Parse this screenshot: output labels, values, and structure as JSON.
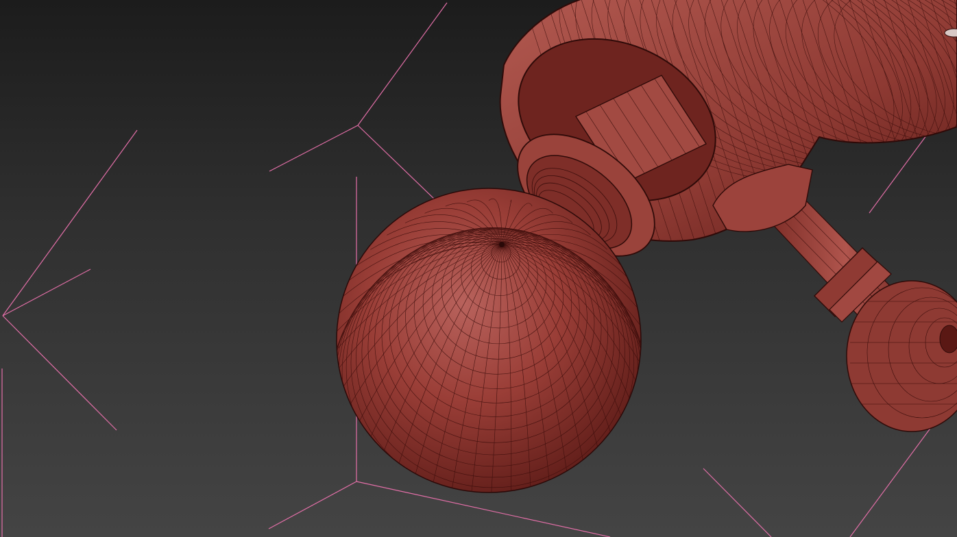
{
  "viewport": {
    "background_top": "#1c1c1c",
    "background_bottom": "#444444",
    "shading": "wireframe-over-shaded",
    "mesh_color": "#a2463e",
    "wire_color": "#3a0d0b",
    "selection_line_color": "#e36fa8"
  },
  "scene_objects": [
    {
      "name": "ball-joint-sphere"
    },
    {
      "name": "threaded-nut"
    },
    {
      "name": "cylindrical-housing"
    },
    {
      "name": "piston-rod"
    },
    {
      "name": "rod-end-bearing"
    }
  ]
}
